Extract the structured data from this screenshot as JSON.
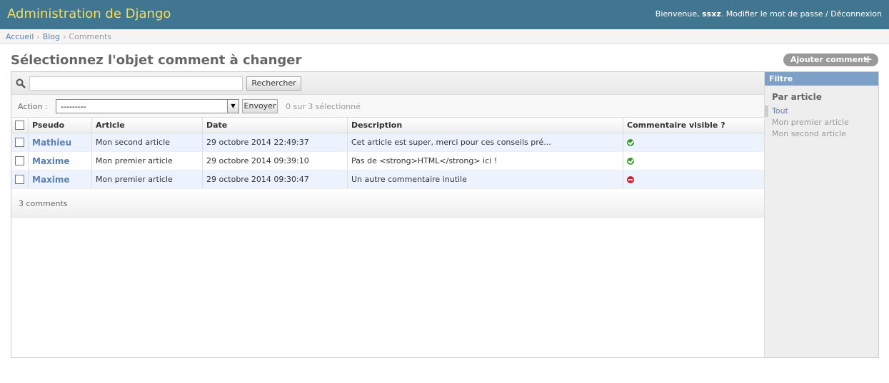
{
  "header": {
    "site_name": "Administration de Django",
    "welcome": "Bienvenue,",
    "username": "ssxz",
    "change_password": "Modifier le mot de passe",
    "separator": "/",
    "logout": "Déconnexion"
  },
  "breadcrumbs": {
    "items": [
      "Accueil",
      "Blog",
      "Comments"
    ],
    "sep": "›"
  },
  "page_title": "Sélectionnez l'objet comment à changer",
  "add_button": {
    "label": "Ajouter comment",
    "icon": "plus-icon"
  },
  "search": {
    "button": "Rechercher",
    "value": "",
    "icon": "search-icon"
  },
  "actions": {
    "label": "Action :",
    "selected_value": "---------",
    "go_button": "Envoyer",
    "counter": "0 sur 3 sélectionné"
  },
  "table": {
    "headers": [
      "Pseudo",
      "Article",
      "Date",
      "Description",
      "Commentaire visible ?"
    ],
    "rows": [
      {
        "pseudo": "Mathieu",
        "article": "Mon second article",
        "date": "29 octobre 2014 22:49:37",
        "description": "Cet article est super, merci pour ces conseils pré...",
        "visible": "yes-icon"
      },
      {
        "pseudo": "Maxime",
        "article": "Mon premier article",
        "date": "29 octobre 2014 09:39:10",
        "description": "Pas de <strong>HTML</strong> ici !",
        "visible": "yes-icon"
      },
      {
        "pseudo": "Maxime",
        "article": "Mon premier article",
        "date": "29 octobre 2014 09:30:47",
        "description": "Un autre commentaire inutile",
        "visible": "no-icon"
      }
    ]
  },
  "paginator": "3 comments",
  "filter": {
    "title": "Filtre",
    "heading": "Par article",
    "options": [
      "Tout",
      "Mon premier article",
      "Mon second article"
    ],
    "selected": "Tout"
  },
  "colors": {
    "header_bg": "#417690",
    "site_name": "#f5dd5d",
    "link": "#5b80b2",
    "filter_title_bg": "#7ca0c7",
    "row_alt_bg": "#edf3fe"
  }
}
